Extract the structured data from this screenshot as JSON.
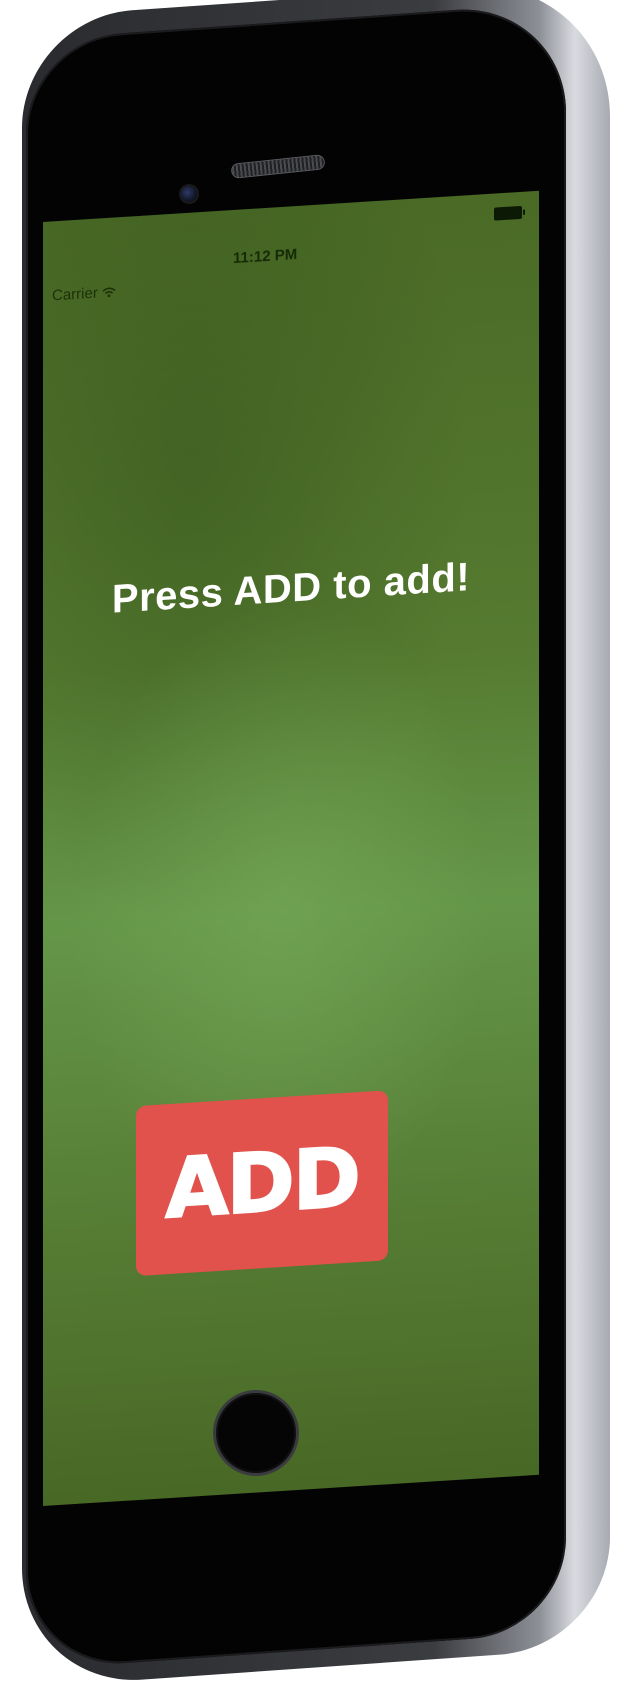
{
  "status_bar": {
    "carrier": "Carrier",
    "time": "11:12 PM",
    "wifi_icon": "wifi-icon",
    "battery_icon": "battery-icon"
  },
  "main": {
    "prompt": "Press ADD to add!",
    "add_button_label": "ADD",
    "background": "green-chalkboard",
    "button_color": "#e0524b"
  },
  "device": {
    "home_button_icon": "home-button"
  }
}
